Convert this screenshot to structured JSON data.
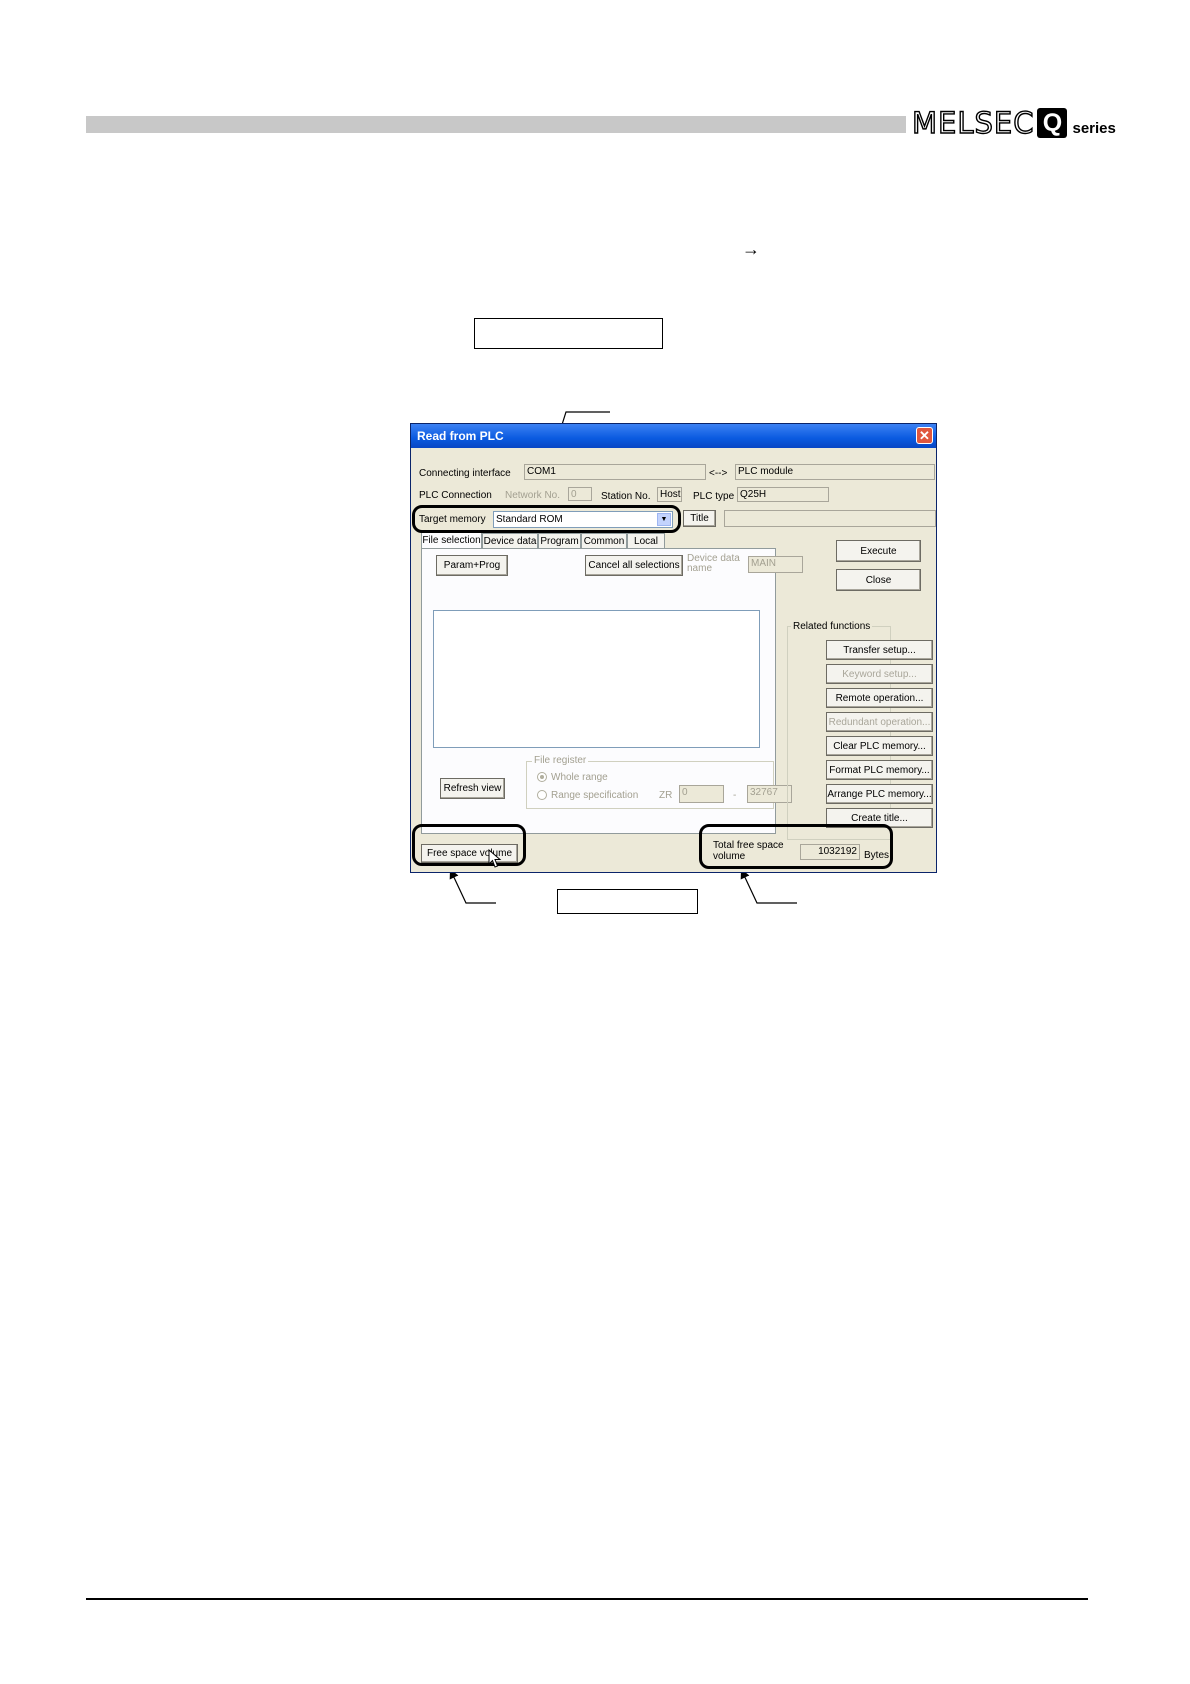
{
  "header": {
    "brand_text": "MELSEC",
    "brand_badge": "Q",
    "brand_suffix": "series"
  },
  "doc": {
    "arrow_glyph": "→"
  },
  "dialog": {
    "title": "Read from PLC",
    "close_glyph": "✕",
    "connecting_interface_label": "Connecting interface",
    "connecting_interface_value": "COM1",
    "arrow_sep": "<-->",
    "plc_module_value": "PLC module",
    "plc_connection_label": "PLC Connection",
    "network_no_label": "Network No.",
    "network_no_value": "0",
    "station_no_label": "Station No.",
    "station_no_value": "Host",
    "plc_type_label": "PLC type",
    "plc_type_value": "Q25H",
    "target_memory_label": "Target memory",
    "target_memory_value": "Standard ROM",
    "dropdown_glyph": "▼",
    "title_button": "Title",
    "title_value": "",
    "tabs": [
      "File selection",
      "Device data",
      "Program",
      "Common",
      "Local"
    ],
    "param_prog_button": "Param+Prog",
    "cancel_all_button": "Cancel all selections",
    "device_data_name_label_1": "Device data",
    "device_data_name_label_2": "name",
    "device_data_name_value": "MAIN",
    "execute_button": "Execute",
    "close_button": "Close",
    "related_functions_label": "Related functions",
    "related_buttons": [
      {
        "label": "Transfer setup..."
      },
      {
        "label": "Keyword setup..."
      },
      {
        "label": "Remote operation..."
      },
      {
        "label": "Redundant operation..."
      },
      {
        "label": "Clear PLC memory..."
      },
      {
        "label": "Format PLC memory..."
      },
      {
        "label": "Arrange PLC memory..."
      },
      {
        "label": "Create title..."
      }
    ],
    "file_register_label": "File register",
    "whole_range_label": "Whole range",
    "range_spec_label": "Range specification",
    "zr_label": "ZR",
    "range_start_value": "0",
    "range_sep": "-",
    "range_end_value": "32767",
    "refresh_view_button": "Refresh view",
    "free_space_button": "Free space volume",
    "total_free_label_1": "Total free space",
    "total_free_label_2": "volume",
    "total_free_value": "1032192",
    "bytes_label": "Bytes"
  }
}
